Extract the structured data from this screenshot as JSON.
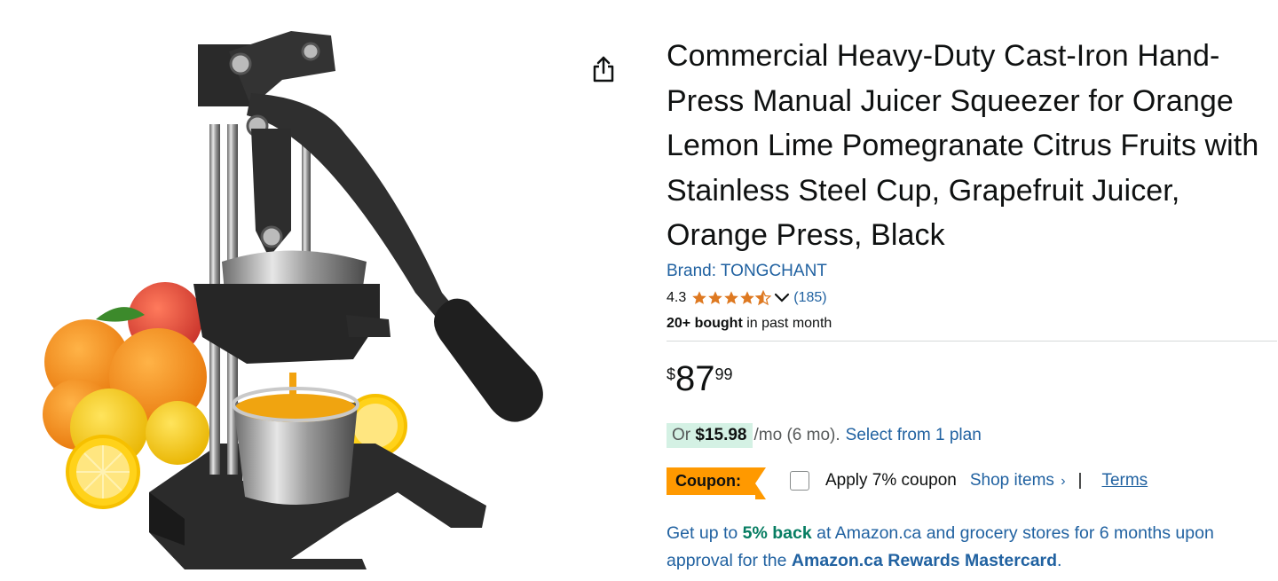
{
  "product": {
    "title": "Commercial Heavy-Duty Cast-Iron Hand-Press Manual Juicer Squeezer for Orange Lemon Lime Pomegranate Citrus Fruits with Stainless Steel Cup, Grapefruit Juicer, Orange Press, Black",
    "brand_link": "Brand: TONGCHANT",
    "rating_value": "4.3",
    "rating_stars": 4.3,
    "rating_count": "(185)",
    "bought_bold": "20+ bought",
    "bought_rest": " in past month"
  },
  "price": {
    "symbol": "$",
    "whole": "87",
    "fraction": "99"
  },
  "plan": {
    "prefix": "Or ",
    "monthly": "$15.98",
    "suffix": "/mo (6 mo).",
    "link": "Select from 1 plan"
  },
  "coupon": {
    "badge": "Coupon:",
    "apply_label": "Apply 7% coupon",
    "shop_items": "Shop items",
    "shop_chevron": "›",
    "separator": "|",
    "terms": "Terms"
  },
  "promo": {
    "part1": "Get up to ",
    "highlight": "5% back",
    "part2": " at Amazon.ca and grocery stores for 6 months upon approval for the ",
    "card": "Amazon.ca Rewards Mastercard",
    "part3": "."
  },
  "icons": {
    "share": "share-icon",
    "star": "star-icon",
    "chevron": "chevron-down-icon"
  },
  "colors": {
    "link_blue": "#2162a1",
    "star_orange": "#de7921",
    "coupon_orange": "#ff9900",
    "plan_highlight": "#d4f1e4",
    "promo_green": "#067d62"
  }
}
